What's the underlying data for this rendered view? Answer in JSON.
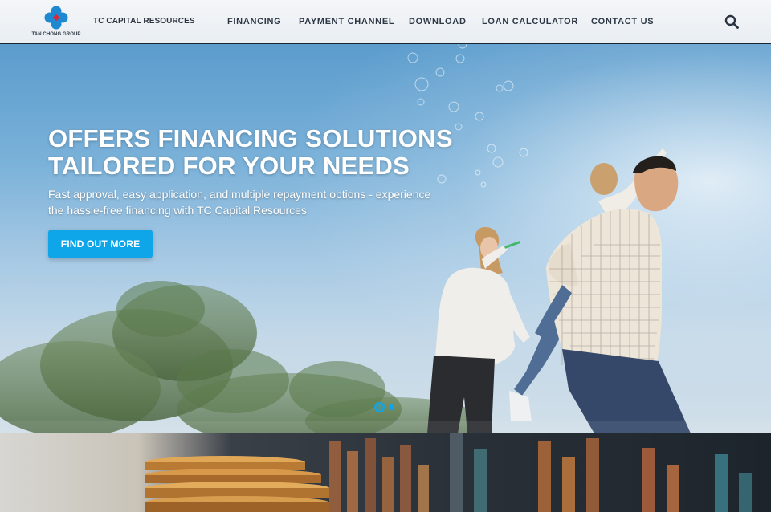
{
  "header": {
    "logo_text": "TAN CHONG GROUP",
    "brand": "TC CAPITAL RESOURCES",
    "nav": [
      {
        "label": "FINANCING"
      },
      {
        "label": "PAYMENT CHANNEL"
      },
      {
        "label": "DOWNLOAD"
      },
      {
        "label": "LOAN CALCULATOR"
      },
      {
        "label": "CONTACT US"
      }
    ],
    "search_icon": "search-icon"
  },
  "hero": {
    "title": "OFFERS FINANCING SOLUTIONS TAILORED FOR YOUR NEEDS",
    "subtitle": "Fast approval, easy application, and multiple repayment options - experience the hassle-free financing with TC Capital Resources",
    "cta_label": "FIND OUT MORE",
    "slides": {
      "count": 2,
      "active": 1
    }
  },
  "colors": {
    "accent": "#0ea5e9",
    "header_bg": "#eef2f6",
    "nav_text": "#2e3845",
    "logo_blue": "#1e88d0",
    "logo_red": "#d8283a"
  }
}
